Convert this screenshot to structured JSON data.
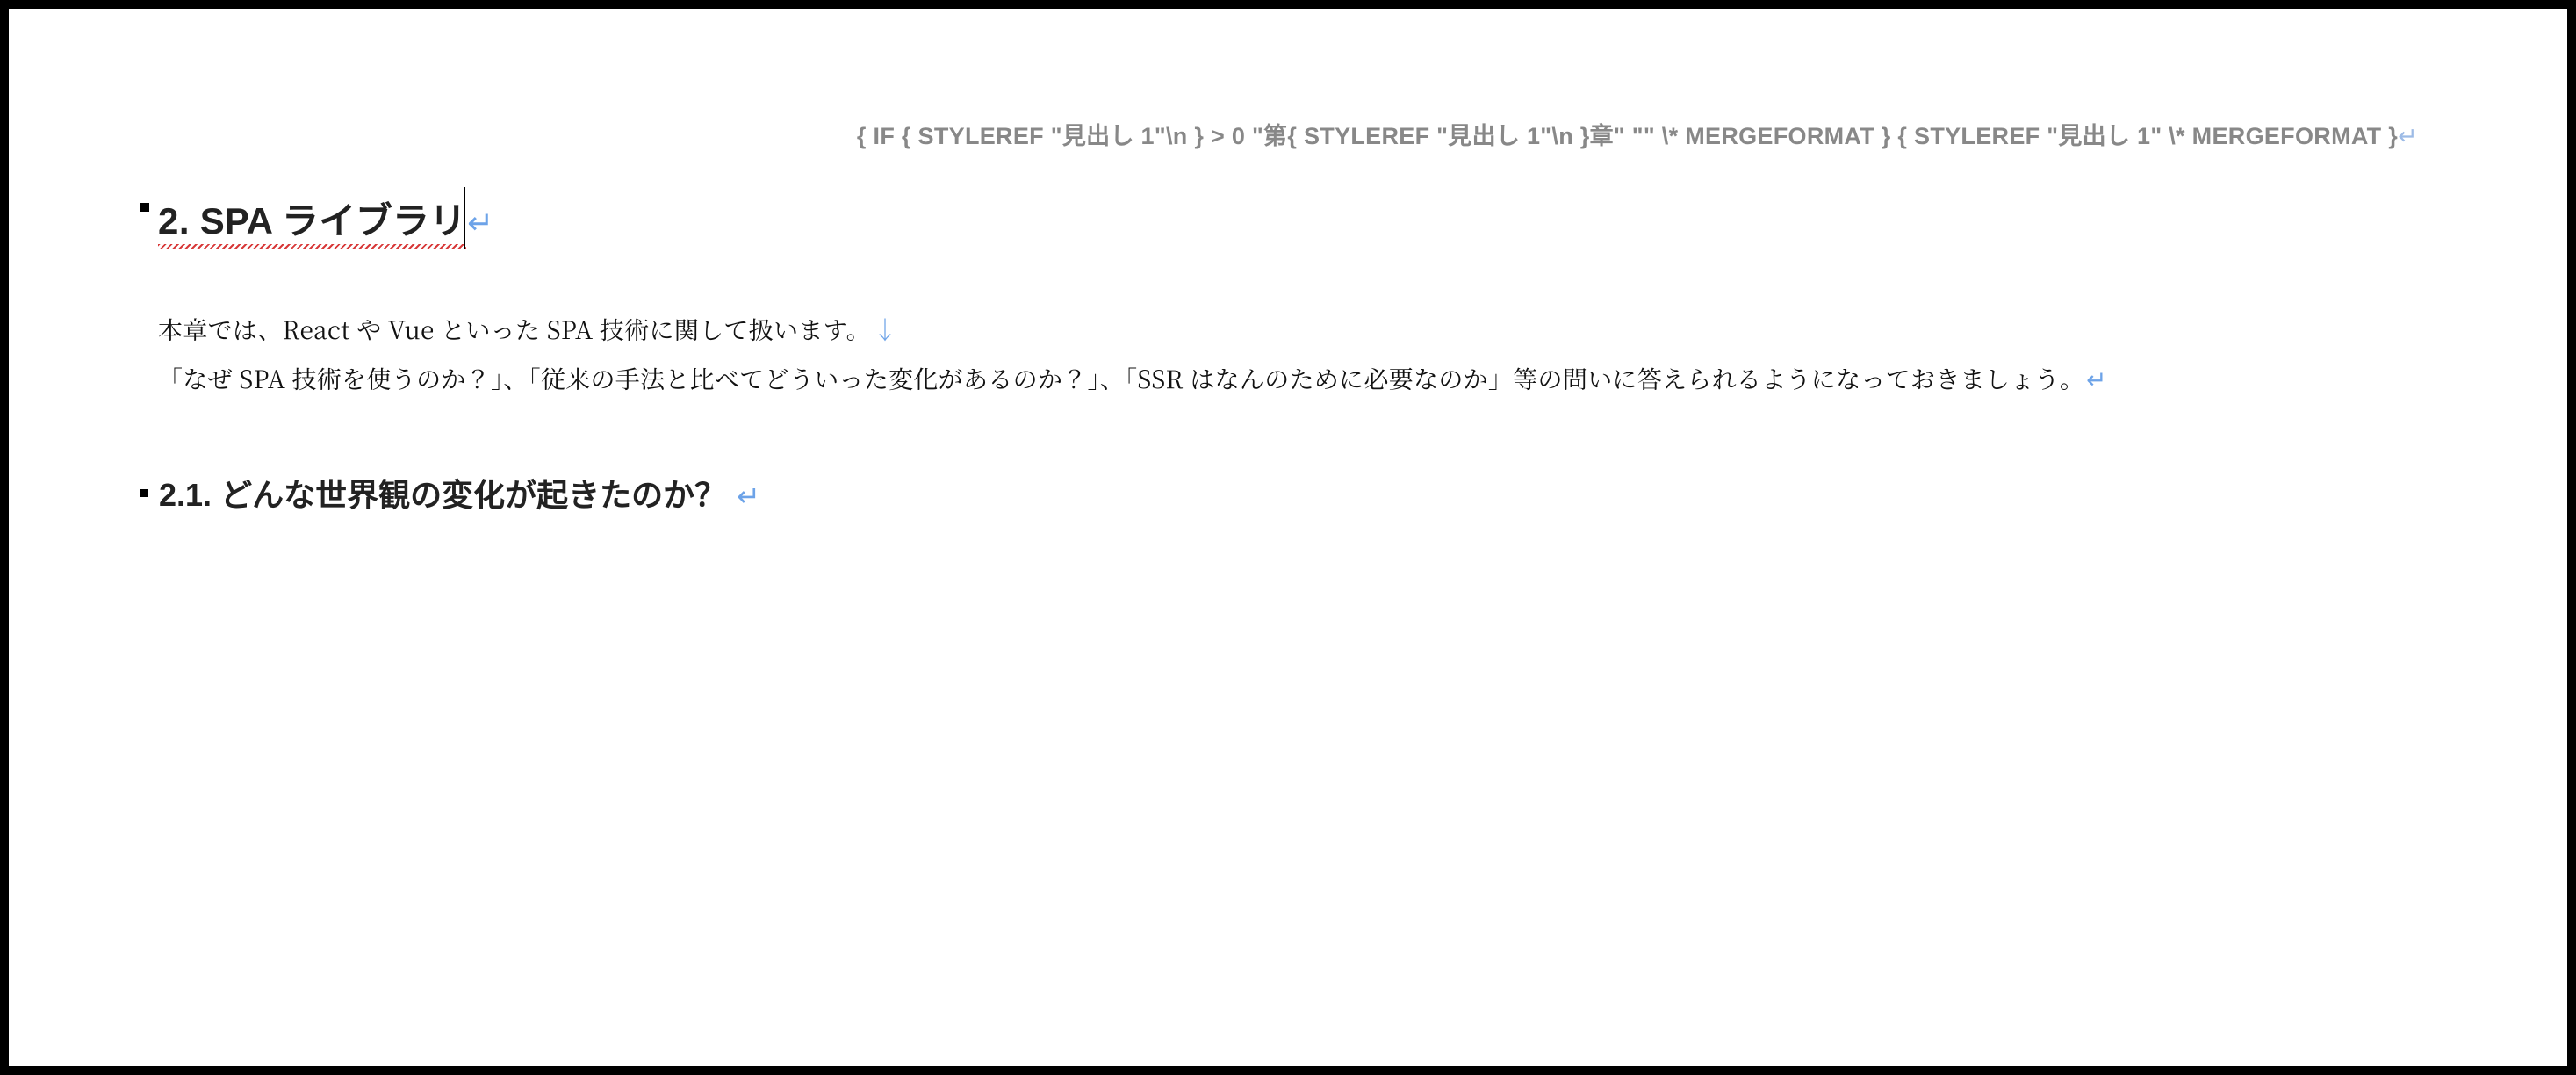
{
  "header": {
    "field_code": "{ IF { STYLEREF \"見出し 1\"\\n } > 0 \"第{ STYLEREF \"見出し 1\"\\n }章\" \"\"  \\* MERGEFORMAT } { STYLEREF \"見出し 1\" \\* MERGEFORMAT }",
    "pilcrow": "↵"
  },
  "heading1": {
    "number": "2.",
    "title": "SPA ライブラリ",
    "pilcrow": "↵",
    "has_spell_underline": true,
    "has_cursor_after": true
  },
  "body": {
    "lines": [
      "本章では、React や Vue といった SPA 技術に関して扱います。",
      "「なぜ SPA 技術を使うのか？」、「従来の手法と比べてどういった変化があるのか？」、「SSR はなんのために必要なのか」等の問いに答えられるようになっておきましょう。"
    ],
    "pilcrow_down": "↓",
    "pilcrow": "↵"
  },
  "heading2": {
    "number": "2.1.",
    "title": "どんな世界観の変化が起きたのか？",
    "pilcrow": "↵"
  }
}
